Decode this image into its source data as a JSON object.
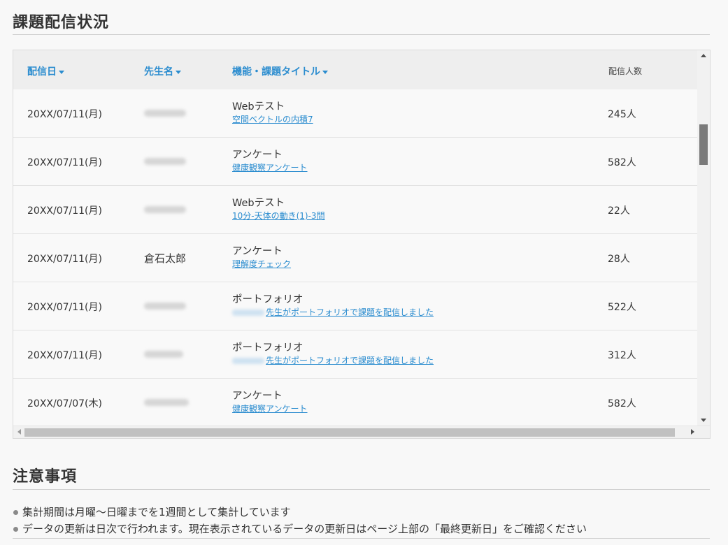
{
  "section1": {
    "title": "課題配信状況"
  },
  "table": {
    "headers": {
      "date": "配信日",
      "teacher": "先生名",
      "title": "機能・課題タイトル",
      "count": "配信人数"
    },
    "rows": [
      {
        "date": "20XX/07/11(月)",
        "teacher": "",
        "kind": "Webテスト",
        "link_prefix": "",
        "link": "空間ベクトルの内積7",
        "count": "245人"
      },
      {
        "date": "20XX/07/11(月)",
        "teacher": "",
        "kind": "アンケート",
        "link_prefix": "",
        "link": "健康観察アンケート",
        "count": "582人"
      },
      {
        "date": "20XX/07/11(月)",
        "teacher": "",
        "kind": "Webテスト",
        "link_prefix": "",
        "link": "10分-天体の動き(1)-3問",
        "count": "22人"
      },
      {
        "date": "20XX/07/11(月)",
        "teacher": "倉石太郎",
        "kind": "アンケート",
        "link_prefix": "",
        "link": "理解度チェック",
        "count": "28人"
      },
      {
        "date": "20XX/07/11(月)",
        "teacher": "",
        "kind": "ポートフォリオ",
        "link_prefix": "blurred",
        "link": "先生がポートフォリオで課題を配信しました",
        "count": "522人"
      },
      {
        "date": "20XX/07/11(月)",
        "teacher": "",
        "kind": "ポートフォリオ",
        "link_prefix": "blurred",
        "link": "先生がポートフォリオで課題を配信しました",
        "count": "312人"
      },
      {
        "date": "20XX/07/07(木)",
        "teacher": "",
        "kind": "アンケート",
        "link_prefix": "",
        "link": "健康観察アンケート",
        "count": "582人"
      }
    ]
  },
  "section2": {
    "title": "注意事項",
    "notes": [
      "集計期間は月曜～日曜までを1週間として集計しています",
      "データの更新は日次で行われます。現在表示されているデータの更新日はページ上部の「最終更新日」をご確認ください"
    ]
  },
  "colors": {
    "accent": "#2a8ccf",
    "text": "#333333",
    "header_bg": "#eeeeee"
  }
}
